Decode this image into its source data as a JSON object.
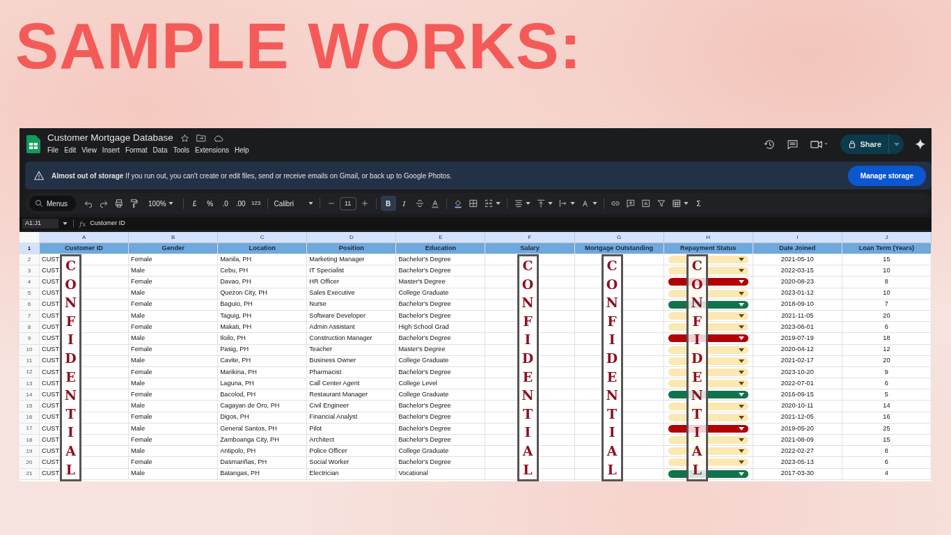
{
  "slide_title": "SAMPLE WORKS:",
  "window": {
    "title": "Customer Mortgage Database"
  },
  "menu": [
    "File",
    "Edit",
    "View",
    "Insert",
    "Format",
    "Data",
    "Tools",
    "Extensions",
    "Help"
  ],
  "share_button": "Share",
  "banner": {
    "message": "**Almost out of storage**  If you run out, you can't create or edit files, send or receive emails on Gmail, or back up to Google Photos.",
    "button": "Manage storage"
  },
  "toolbar": {
    "search": "Menus",
    "zoom": "100%",
    "currency": "£",
    "percent": "%",
    "decrease_decimals": ".0",
    "increase_decimals": ".00",
    "number_format": "123",
    "font": "Calibri",
    "font_size": "11",
    "bold": "B",
    "bold_on": true,
    "italic": "I",
    "sum": "Σ"
  },
  "formula_bar": {
    "name_box": "A1:J1",
    "fx": "fx",
    "content": "Customer ID"
  },
  "table": {
    "columns": [
      "A",
      "B",
      "C",
      "D",
      "E",
      "F",
      "G",
      "H",
      "I",
      "J"
    ],
    "row_numbers": [
      "1",
      "2",
      "3",
      "4",
      "5",
      "6",
      "7",
      "8",
      "9",
      "10",
      "11",
      "12",
      "13",
      "14",
      "15",
      "16",
      "17",
      "18",
      "19",
      "20",
      "21"
    ],
    "headers": [
      "Customer ID",
      "Gender",
      "Location",
      "Position",
      "Education",
      "Salary",
      "Mortgage Outstanding",
      "Repayment Status",
      "Date Joined",
      "Loan Term (Years)"
    ],
    "rows": [
      {
        "id": "CUST",
        "gender": "Female",
        "location": "Manila, PH",
        "position": "Marketing Manager",
        "education": "Bachelor's Degree",
        "status": {
          "color": "#fce8b2"
        },
        "date": "2021-05-10",
        "term": "15"
      },
      {
        "id": "CUST",
        "gender": "Male",
        "location": "Cebu, PH",
        "position": "IT Specialist",
        "education": "Bachelor's Degree",
        "status": {
          "color": "#fce8b2"
        },
        "date": "2022-03-15",
        "term": "10"
      },
      {
        "id": "CUST",
        "gender": "Female",
        "location": "Davao, PH",
        "position": "HR Officer",
        "education": "Master's Degree",
        "status": {
          "color": "#b10202"
        },
        "date": "2020-08-23",
        "term": "8"
      },
      {
        "id": "CUST",
        "gender": "Male",
        "location": "Quezon City, PH",
        "position": "Sales Executive",
        "education": "College Graduate",
        "status": {
          "color": "#fce8b2"
        },
        "date": "2023-01-12",
        "term": "10"
      },
      {
        "id": "CUST",
        "gender": "Female",
        "location": "Baguio, PH",
        "position": "Nurse",
        "education": "Bachelor's Degree",
        "status": {
          "color": "#11734b"
        },
        "date": "2018-09-10",
        "term": "7"
      },
      {
        "id": "CUST",
        "gender": "Male",
        "location": "Taguig, PH",
        "position": "Software Developer",
        "education": "Bachelor's Degree",
        "status": {
          "color": "#fce8b2"
        },
        "date": "2021-11-05",
        "term": "20"
      },
      {
        "id": "CUST",
        "gender": "Female",
        "location": "Makati, PH",
        "position": "Admin Assistant",
        "education": "High School Grad",
        "status": {
          "color": "#fce8b2"
        },
        "date": "2023-06-01",
        "term": "6"
      },
      {
        "id": "CUST",
        "gender": "Male",
        "location": "Iloilo, PH",
        "position": "Construction Manager",
        "education": "Bachelor's Degree",
        "status": {
          "color": "#b10202"
        },
        "date": "2019-07-19",
        "term": "18"
      },
      {
        "id": "CUST",
        "gender": "Female",
        "location": "Pasig, PH",
        "position": "Teacher",
        "education": "Master's Degree",
        "status": {
          "color": "#fce8b2"
        },
        "date": "2020-04-12",
        "term": "12"
      },
      {
        "id": "CUST",
        "gender": "Male",
        "location": "Cavite, PH",
        "position": "Business Owner",
        "education": "College Graduate",
        "status": {
          "color": "#fce8b2"
        },
        "date": "2021-02-17",
        "term": "20"
      },
      {
        "id": "CUST",
        "gender": "Female",
        "location": "Marikina, PH",
        "position": "Pharmacist",
        "education": "Bachelor's Degree",
        "status": {
          "color": "#fce8b2"
        },
        "date": "2023-10-20",
        "term": "9"
      },
      {
        "id": "CUST",
        "gender": "Male",
        "location": "Laguna, PH",
        "position": "Call Center Agent",
        "education": "College Level",
        "status": {
          "color": "#fce8b2"
        },
        "date": "2022-07-01",
        "term": "6"
      },
      {
        "id": "CUST",
        "gender": "Female",
        "location": "Bacolod, PH",
        "position": "Restaurant Manager",
        "education": "College Graduate",
        "status": {
          "color": "#11734b"
        },
        "date": "2016-09-15",
        "term": "5"
      },
      {
        "id": "CUST",
        "gender": "Male",
        "location": "Cagayan de Oro, PH",
        "position": "Civil Engineer",
        "education": "Bachelor's Degree",
        "status": {
          "color": "#fce8b2"
        },
        "date": "2020-10-11",
        "term": "14"
      },
      {
        "id": "CUST",
        "gender": "Female",
        "location": "Digos, PH",
        "position": "Financial Analyst",
        "education": "Bachelor's Degree",
        "status": {
          "color": "#fce8b2"
        },
        "date": "2021-12-05",
        "term": "16"
      },
      {
        "id": "CUST",
        "gender": "Male",
        "location": "General Santos, PH",
        "position": "Pilot",
        "education": "Bachelor's Degree",
        "status": {
          "color": "#b10202"
        },
        "date": "2019-05-20",
        "term": "25"
      },
      {
        "id": "CUST",
        "gender": "Female",
        "location": "Zamboanga City, PH",
        "position": "Architect",
        "education": "Bachelor's Degree",
        "status": {
          "color": "#fce8b2"
        },
        "date": "2021-08-09",
        "term": "15"
      },
      {
        "id": "CUST",
        "gender": "Male",
        "location": "Antipolo, PH",
        "position": "Police Officer",
        "education": "College Graduate",
        "status": {
          "color": "#fce8b2"
        },
        "date": "2022-02-27",
        "term": "8"
      },
      {
        "id": "CUST",
        "gender": "Female",
        "location": "Dasmariñas, PH",
        "position": "Social Worker",
        "education": "Bachelor's Degree",
        "status": {
          "color": "#fce8b2"
        },
        "date": "2023-05-13",
        "term": "6"
      },
      {
        "id": "CUST",
        "gender": "Male",
        "location": "Batangas, PH",
        "position": "Electrician",
        "education": "Vocational",
        "status": {
          "color": "#11734b"
        },
        "date": "2017-03-30",
        "term": "4"
      }
    ]
  },
  "overlays": [
    {
      "text": "CONFIDENTIAL"
    },
    {
      "text": "CONFIDENTIAL"
    },
    {
      "text": "CONFIDENTIAL"
    },
    {
      "text": "CONFIDENTIAL"
    }
  ]
}
